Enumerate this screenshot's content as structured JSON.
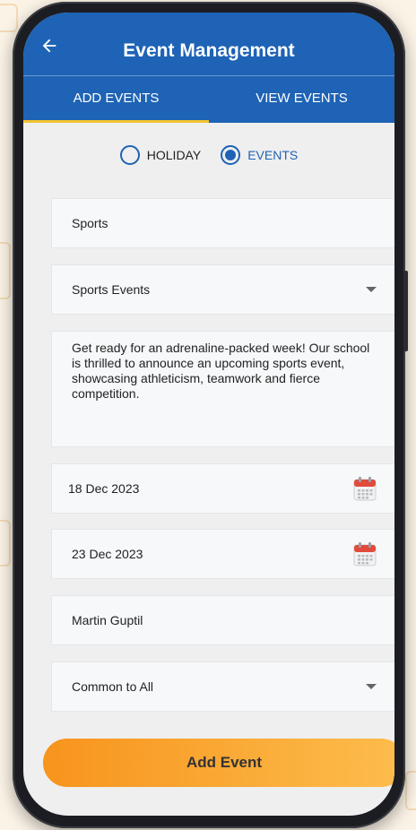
{
  "appbar": {
    "title": "Event Management"
  },
  "tabs": [
    {
      "label": "ADD EVENTS",
      "active": true
    },
    {
      "label": "VIEW EVENTS",
      "active": false
    }
  ],
  "event_type": {
    "options": [
      {
        "label": "HOLIDAY",
        "selected": false
      },
      {
        "label": "EVENTS",
        "selected": true
      }
    ]
  },
  "form": {
    "title_value": "Sports",
    "category_value": "Sports Events",
    "description_value": "Get ready for an adrenaline-packed week! Our school is thrilled to announce an upcoming sports event, showcasing athleticism, teamwork and fierce competition.",
    "start_date": "18 Dec 2023",
    "end_date": "23 Dec 2023",
    "organizer_value": "Martin Guptil",
    "audience_value": "Common to All"
  },
  "actions": {
    "submit_label": "Add Event"
  },
  "colors": {
    "primary": "#1e63b5",
    "tab_indicator": "#f1c232",
    "button_gradient_start": "#f7941d",
    "button_gradient_end": "#fdbd4d",
    "calendar_header": "#e14b3c"
  },
  "icons": {
    "back": "arrow-left-icon",
    "dropdown": "chevron-down-icon",
    "calendar": "calendar-icon"
  }
}
